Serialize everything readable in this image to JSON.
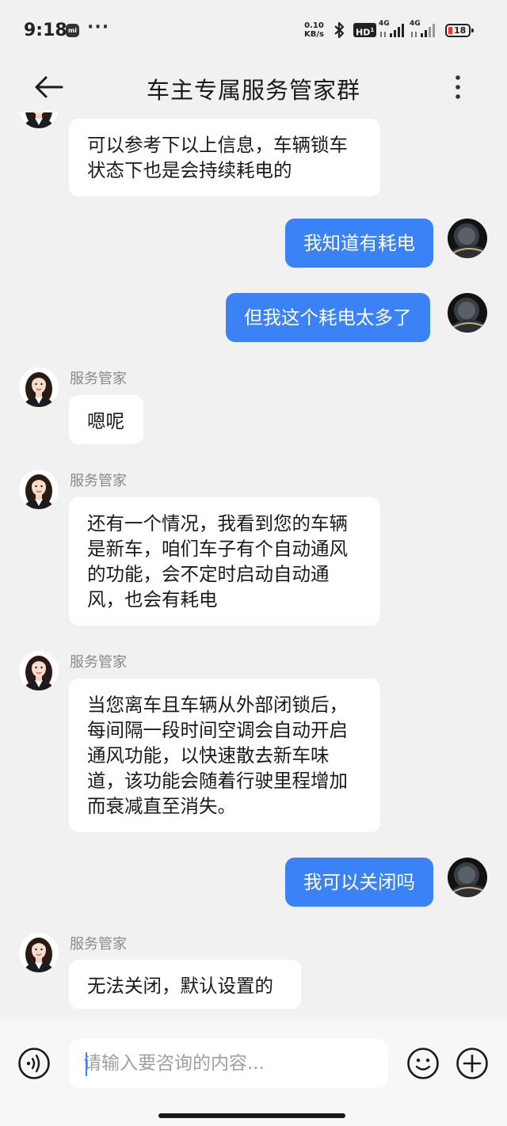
{
  "status_bar": {
    "time": "9:18",
    "net_speed_value": "0.10",
    "net_speed_unit": "KB/s",
    "hd_label": "HD",
    "signal1_label": "4G",
    "signal2_label": "4G",
    "battery_level": "18",
    "icons": [
      "mi-app-icon",
      "more-notifications-icon",
      "bluetooth-icon",
      "hd-voice-icon",
      "signal-icon",
      "battery-icon"
    ]
  },
  "header": {
    "title": "车主专属服务管家群",
    "back_icon": "arrow-left-icon",
    "more_icon": "more-vertical-icon"
  },
  "messages": [
    {
      "direction": "in",
      "sender": "",
      "text": "可以参考下以上信息，车辆锁车状态下也是会持续耗电的"
    },
    {
      "direction": "out",
      "text": "我知道有耗电"
    },
    {
      "direction": "out",
      "text": "但我这个耗电太多了"
    },
    {
      "direction": "in",
      "sender": "服务管家",
      "text": "嗯呢"
    },
    {
      "direction": "in",
      "sender": "服务管家",
      "text": "还有一个情况，我看到您的车辆是新车，咱们车子有个自动通风的功能，会不定时启动自动通风，也会有耗电"
    },
    {
      "direction": "in",
      "sender": "服务管家",
      "text": "当您离车且车辆从外部闭锁后，每间隔一段时间空调会自动开启通风功能，以快速散去新车味道，该功能会随着行驶里程增加而衰减直至消失。"
    },
    {
      "direction": "out",
      "text": "我可以关闭吗"
    },
    {
      "direction": "in",
      "sender": "服务管家",
      "text": "无法关闭，默认设置的"
    }
  ],
  "input_bar": {
    "placeholder": "请输入要咨询的内容...",
    "value": "",
    "voice_icon": "voice-input-icon",
    "emoji_icon": "emoji-icon",
    "plus_icon": "plus-circle-icon"
  },
  "colors": {
    "background": "#f1f1f1",
    "outgoing_bubble": "#3b82f6",
    "incoming_bubble": "#ffffff",
    "sender_name": "#8a8a8a"
  }
}
